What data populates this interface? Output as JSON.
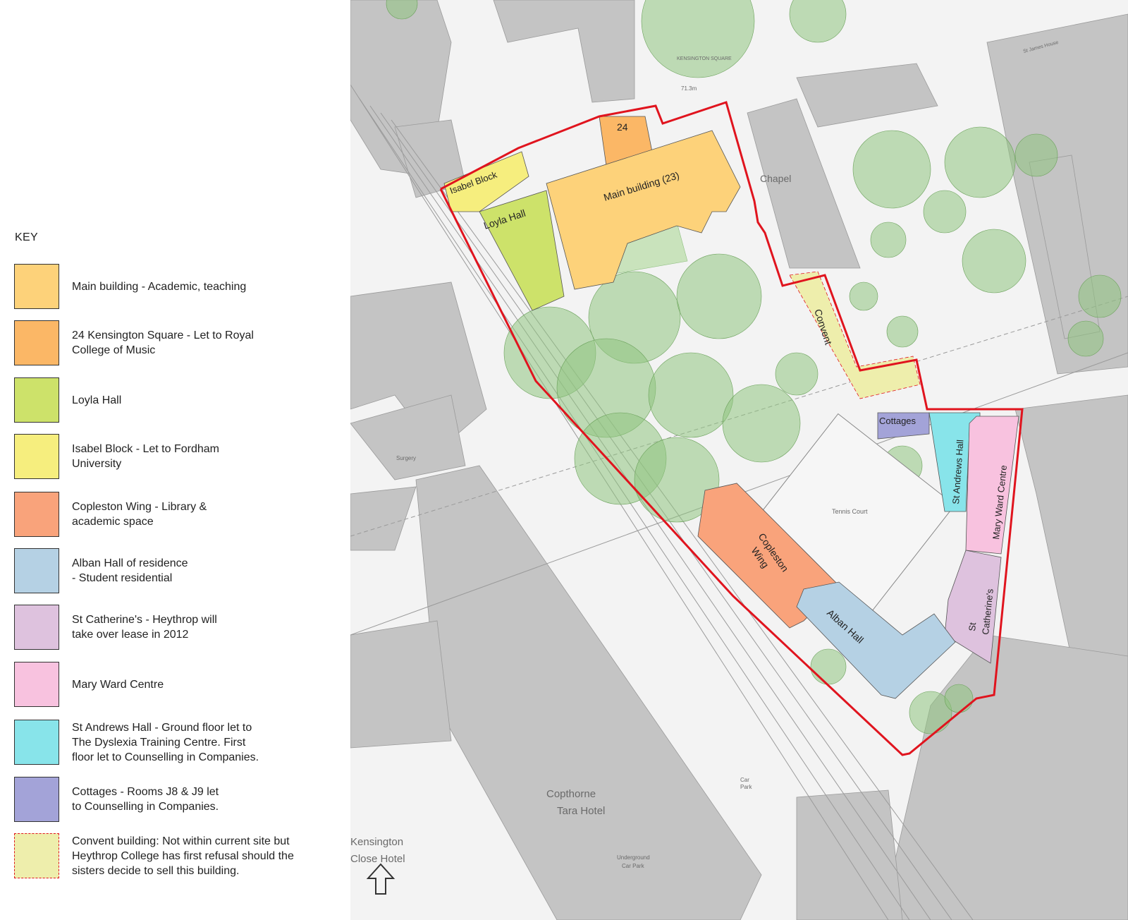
{
  "key": {
    "title": "KEY",
    "items": [
      {
        "label": "Main building - Academic, teaching",
        "color": "#fdd27a"
      },
      {
        "label": "24 Kensington Square - Let to Royal\nCollege of Music",
        "color": "#fbb766"
      },
      {
        "label": "Loyla Hall",
        "color": "#cde26a"
      },
      {
        "label": "Isabel Block - Let to Fordham\nUniversity",
        "color": "#f6ee7e"
      },
      {
        "label": "Copleston Wing - Library &\nacademic space",
        "color": "#f9a37b"
      },
      {
        "label": "Alban Hall of residence\n- Student residential",
        "color": "#b5d1e4"
      },
      {
        "label": "St Catherine's  - Heythrop will\ntake over lease in 2012",
        "color": "#dec2de"
      },
      {
        "label": "Mary Ward Centre",
        "color": "#f8c2df"
      },
      {
        "label": "St Andrews Hall - Ground floor let to\nThe Dyslexia Training Centre. First\nfloor let to Counselling in Companies.",
        "color": "#88e4ea"
      },
      {
        "label": "Cottages - Rooms J8 & J9 let\nto Counselling in Companies.",
        "color": "#a3a3d8"
      },
      {
        "label": "Convent building: Not within current site but\nHeythrop College has first refusal should the\nsisters decide to sell this building.",
        "color": "#eeeeac",
        "border": "dashed-red"
      }
    ]
  },
  "map": {
    "site_boundary_color": "#e0141e",
    "labels": {
      "isabel_block": "Isabel Block",
      "twenty_four": "24",
      "main_building": "Main building (23)",
      "loyla_hall": "Loyla Hall",
      "chapel": "Chapel",
      "convent": "Convent",
      "cottages": "Cottages",
      "st_andrews_hall": "St Andrews Hall",
      "mary_ward_centre": "Mary Ward Centre",
      "st_catherines_1": "St",
      "st_catherines_2": "Catherine's",
      "copleston_1": "Copleston",
      "copleston_2": "Wing",
      "alban_hall": "Alban Hall",
      "tennis_court": "Tennis Court",
      "copthorne_1": "Copthorne",
      "copthorne_2": "Tara Hotel",
      "kensington_close_1": "Kensington",
      "kensington_close_2": "Close Hotel",
      "car_park_1": "Car",
      "car_park_2": "Park",
      "underground_1": "Underground",
      "underground_2": "Car Park",
      "surgery": "Surgery",
      "kensington_square": "KENSINGTON SQUARE",
      "height_mark": "71.3m",
      "st_james_house": "St James House"
    },
    "north_arrow_icon": "north-arrow-icon"
  }
}
